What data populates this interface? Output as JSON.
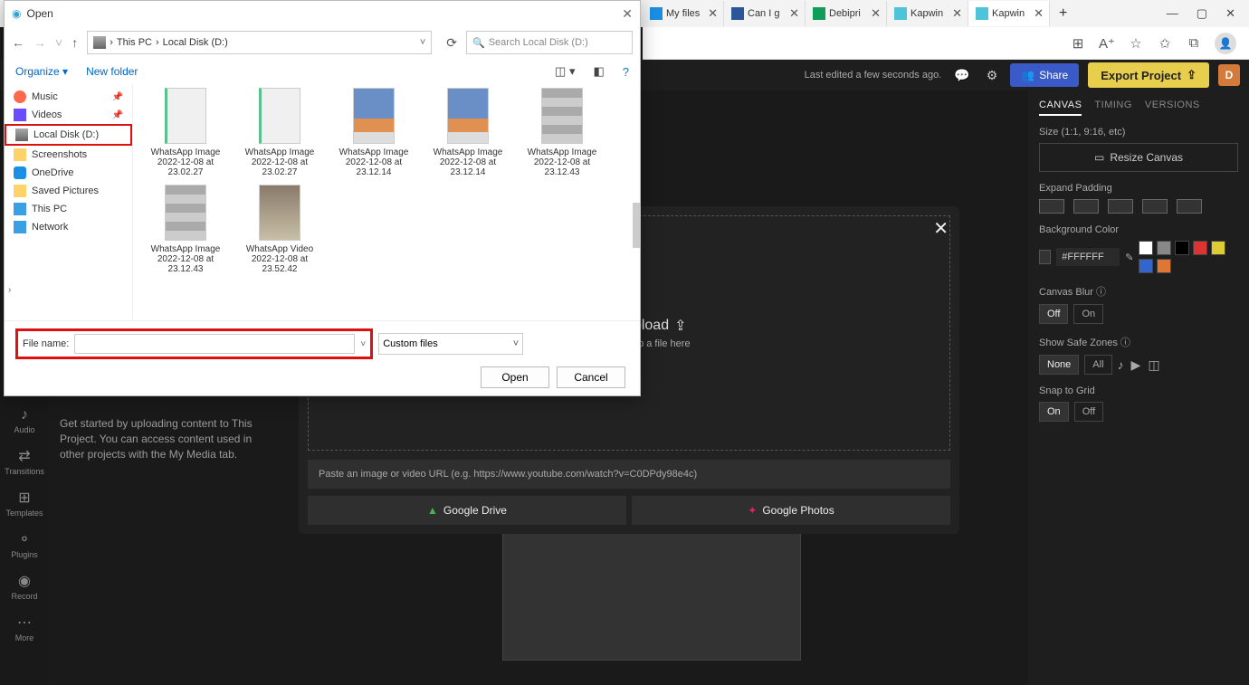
{
  "browser": {
    "tabs": [
      {
        "label": "",
        "hidden": true
      },
      {
        "label": "My files",
        "icon": "onedrive"
      },
      {
        "label": "Can I g",
        "icon": "word"
      },
      {
        "label": "Debipri",
        "icon": "sheets"
      },
      {
        "label": "Kapwin",
        "icon": "kapwing"
      },
      {
        "label": "Kapwin",
        "icon": "kapwing",
        "active": true
      }
    ],
    "toolbar_icons": [
      "extensions",
      "read-aloud",
      "favorite",
      "collections",
      "app",
      "profile"
    ]
  },
  "kapwing": {
    "last_edit": "Last edited a few seconds ago.",
    "share": "Share",
    "export": "Export Project",
    "user_initial": "D",
    "tools": [
      {
        "icon": "♪",
        "label": "Audio"
      },
      {
        "icon": "⇄",
        "label": "Transitions"
      },
      {
        "icon": "⊞",
        "label": "Templates"
      },
      {
        "icon": "⚬",
        "label": "Plugins"
      },
      {
        "icon": "◉",
        "label": "Record"
      },
      {
        "icon": "⋯",
        "label": "More"
      }
    ],
    "left_panel_help": "Get started by uploading content to This Project. You can access content used in other projects with the My Media tab."
  },
  "upload": {
    "title": "Click to Upload",
    "subtitle": "Or drag and drop a file here",
    "paste_placeholder": "Paste an image or video URL (e.g. https://www.youtube.com/watch?v=C0DPdy98e4c)",
    "gdrive": "Google Drive",
    "gphotos": "Google Photos"
  },
  "right_panel": {
    "tabs": [
      "CANVAS",
      "TIMING",
      "VERSIONS"
    ],
    "active_tab": 0,
    "size_label": "Size (1:1, 9:16, etc)",
    "resize": "Resize Canvas",
    "expand_label": "Expand Padding",
    "bg_label": "Background Color",
    "bg_value": "#FFFFFF",
    "swatches": [
      "#ffffff",
      "#888888",
      "#000000",
      "#d33",
      "#dc3",
      "#36c",
      "#d73"
    ],
    "blur_label": "Canvas Blur",
    "blur_options": [
      "Off",
      "On"
    ],
    "safe_label": "Show Safe Zones",
    "safe_options": [
      "None",
      "All"
    ],
    "snap_label": "Snap to Grid",
    "snap_options": [
      "On",
      "Off"
    ]
  },
  "dialog": {
    "title": "Open",
    "breadcrumb": [
      "This PC",
      "Local Disk (D:)"
    ],
    "search_placeholder": "Search Local Disk (D:)",
    "organize": "Organize",
    "newfolder": "New folder",
    "sidebar": [
      {
        "label": "Music",
        "ic": "ic-music",
        "pin": true
      },
      {
        "label": "Videos",
        "ic": "ic-video",
        "pin": true
      },
      {
        "label": "Local Disk (D:)",
        "ic": "ic-disk",
        "hl": true
      },
      {
        "label": "Screenshots",
        "ic": "ic-folder"
      },
      {
        "label": "OneDrive",
        "ic": "ic-cloud"
      },
      {
        "label": "Saved Pictures",
        "ic": "ic-folder"
      },
      {
        "label": "This PC",
        "ic": "ic-pc",
        "expand": true
      },
      {
        "label": "Network",
        "ic": "ic-net",
        "expand": true
      }
    ],
    "files": [
      {
        "name": "WhatsApp Image 2022-12-08 at 23.02.27",
        "thumb": "chat"
      },
      {
        "name": "WhatsApp Image 2022-12-08 at 23.02.27",
        "thumb": "chat"
      },
      {
        "name": "WhatsApp Image 2022-12-08 at 23.12.14",
        "thumb": ""
      },
      {
        "name": "WhatsApp Image 2022-12-08 at 23.12.14",
        "thumb": ""
      },
      {
        "name": "WhatsApp Image 2022-12-08 at 23.12.43",
        "thumb": "gallery"
      },
      {
        "name": "WhatsApp Image 2022-12-08 at 23.12.43",
        "thumb": "gallery"
      },
      {
        "name": "WhatsApp Video 2022-12-08 at 23.52.42",
        "thumb": "vid"
      }
    ],
    "filename_label": "File name:",
    "filename_value": "",
    "filetype": "Custom files",
    "open_btn": "Open",
    "cancel_btn": "Cancel"
  }
}
